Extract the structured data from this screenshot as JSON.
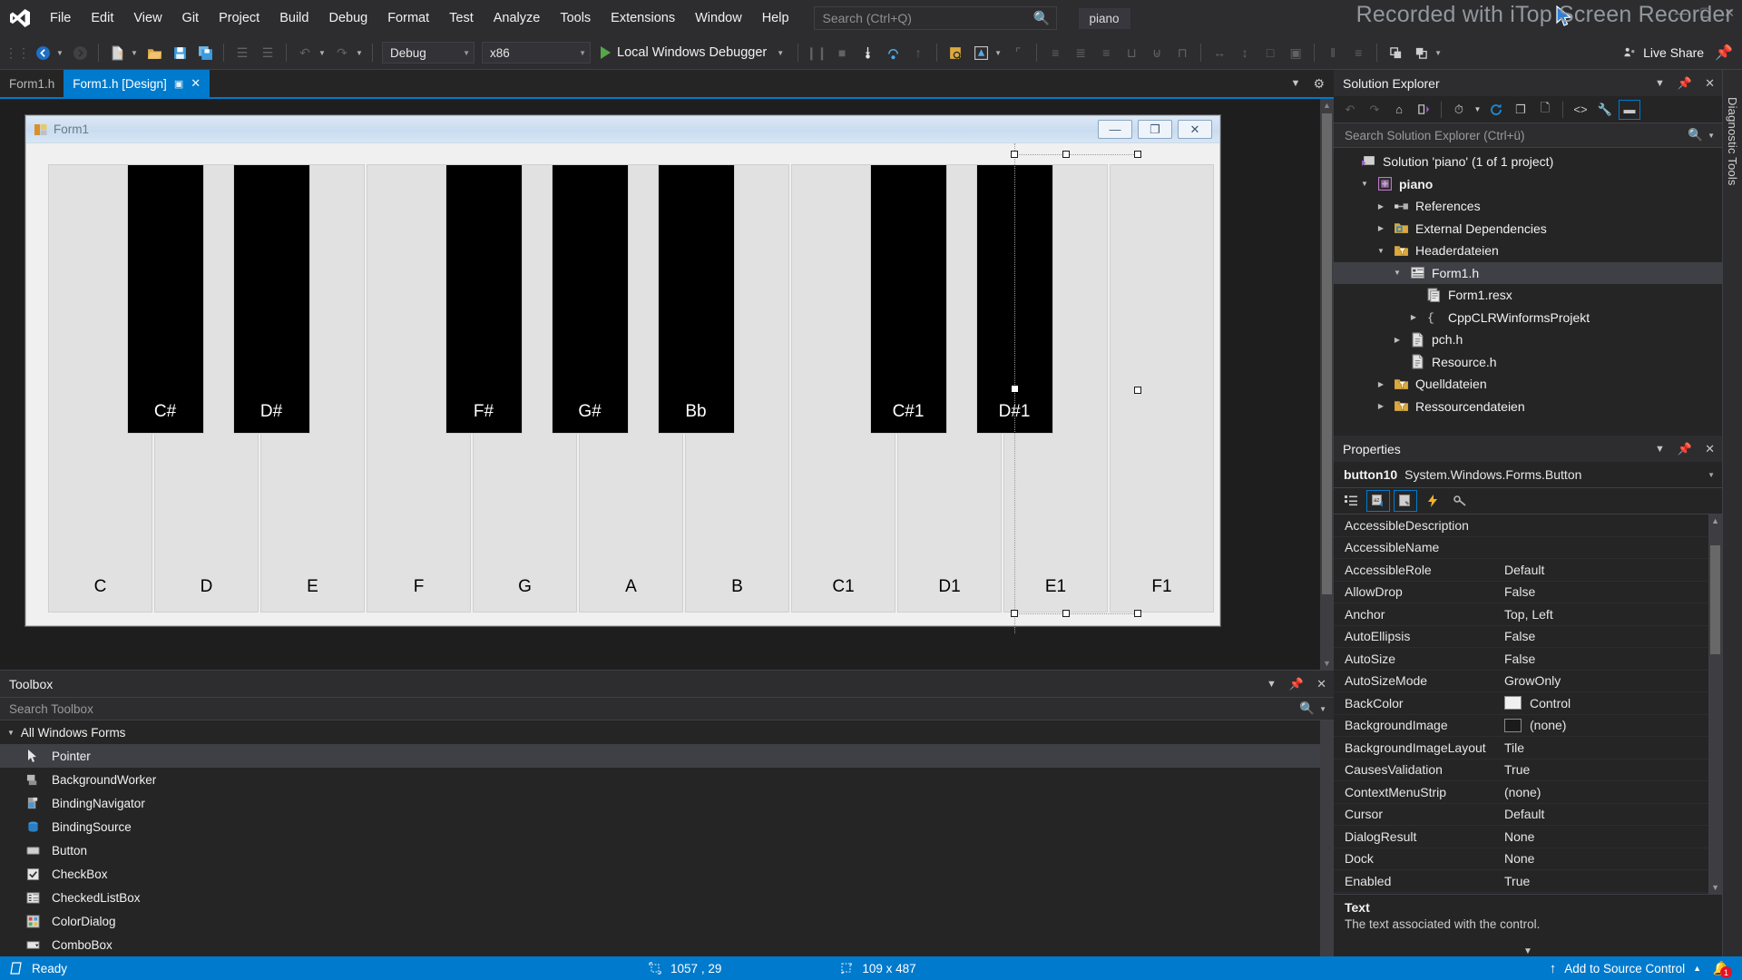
{
  "menu": {
    "items": [
      "File",
      "Edit",
      "View",
      "Git",
      "Project",
      "Build",
      "Debug",
      "Format",
      "Test",
      "Analyze",
      "Tools",
      "Extensions",
      "Window",
      "Help"
    ],
    "search_placeholder": "Search (Ctrl+Q)",
    "project_chip": "piano",
    "watermark": "Recorded with iTop Screen Recorder"
  },
  "toolbar": {
    "configuration": "Debug",
    "platform": "x86",
    "run_label": "Local Windows Debugger",
    "live_share": "Live Share"
  },
  "tabs": {
    "items": [
      {
        "label": "Form1.h",
        "active": false
      },
      {
        "label": "Form1.h [Design]",
        "active": true
      }
    ]
  },
  "designer": {
    "form_title": "Form1",
    "window_buttons": {
      "minimize": "—",
      "maximize": "❐",
      "close": "✕"
    },
    "white_keys": [
      "C",
      "D",
      "E",
      "F",
      "G",
      "A",
      "B",
      "C1",
      "D1",
      "E1",
      "F1"
    ],
    "black_keys": [
      {
        "label": "C#",
        "after": 0
      },
      {
        "label": "D#",
        "after": 1
      },
      {
        "label": "F#",
        "after": 3
      },
      {
        "label": "G#",
        "after": 4
      },
      {
        "label": "Bb",
        "after": 5
      },
      {
        "label": "C#1",
        "after": 7
      },
      {
        "label": "D#1",
        "after": 8
      }
    ],
    "selected_key": "D#1"
  },
  "toolbox": {
    "title": "Toolbox",
    "search_placeholder": "Search Toolbox",
    "group": "All Windows Forms",
    "items": [
      {
        "label": "Pointer",
        "icon": "pointer-icon",
        "selected": true
      },
      {
        "label": "BackgroundWorker",
        "icon": "background-worker-icon",
        "selected": false
      },
      {
        "label": "BindingNavigator",
        "icon": "binding-navigator-icon",
        "selected": false
      },
      {
        "label": "BindingSource",
        "icon": "binding-source-icon",
        "selected": false
      },
      {
        "label": "Button",
        "icon": "button-icon",
        "selected": false
      },
      {
        "label": "CheckBox",
        "icon": "checkbox-icon",
        "selected": false
      },
      {
        "label": "CheckedListBox",
        "icon": "checked-list-box-icon",
        "selected": false
      },
      {
        "label": "ColorDialog",
        "icon": "color-dialog-icon",
        "selected": false
      },
      {
        "label": "ComboBox",
        "icon": "combo-box-icon",
        "selected": false
      }
    ]
  },
  "solution_explorer": {
    "title": "Solution Explorer",
    "search_placeholder": "Search Solution Explorer (Ctrl+ü)",
    "tree": [
      {
        "label": "Solution 'piano' (1 of 1 project)",
        "indent": 0,
        "tri": "none",
        "icon": "solution-icon",
        "bold": false,
        "selected": false
      },
      {
        "label": "piano",
        "indent": 1,
        "tri": "open",
        "icon": "project-icon",
        "bold": true,
        "selected": false
      },
      {
        "label": "References",
        "indent": 2,
        "tri": "closed",
        "icon": "references-icon",
        "bold": false,
        "selected": false
      },
      {
        "label": "External Dependencies",
        "indent": 2,
        "tri": "closed",
        "icon": "ext-dep-icon",
        "bold": false,
        "selected": false
      },
      {
        "label": "Headerdateien",
        "indent": 2,
        "tri": "open",
        "icon": "folder-filter-icon",
        "bold": false,
        "selected": false
      },
      {
        "label": "Form1.h",
        "indent": 3,
        "tri": "open",
        "icon": "form-icon",
        "bold": false,
        "selected": true
      },
      {
        "label": "Form1.resx",
        "indent": 4,
        "tri": "none",
        "icon": "resx-icon",
        "bold": false,
        "selected": false
      },
      {
        "label": "CppCLRWinformsProjekt",
        "indent": 4,
        "tri": "closed",
        "icon": "braces-icon",
        "bold": false,
        "selected": false
      },
      {
        "label": "pch.h",
        "indent": 3,
        "tri": "closed",
        "icon": "header-file-icon",
        "bold": false,
        "selected": false
      },
      {
        "label": "Resource.h",
        "indent": 3,
        "tri": "none",
        "icon": "header-file-icon",
        "bold": false,
        "selected": false
      },
      {
        "label": "Quelldateien",
        "indent": 2,
        "tri": "closed",
        "icon": "folder-filter-icon",
        "bold": false,
        "selected": false
      },
      {
        "label": "Ressourcendateien",
        "indent": 2,
        "tri": "closed",
        "icon": "folder-filter-icon",
        "bold": false,
        "selected": false
      }
    ]
  },
  "diagnostic_tools_tab": "Diagnostic Tools",
  "properties": {
    "title": "Properties",
    "object_name": "button10",
    "object_type": "System.Windows.Forms.Button",
    "rows": [
      {
        "key": "AccessibleDescription",
        "value": "",
        "swatch": ""
      },
      {
        "key": "AccessibleName",
        "value": "",
        "swatch": ""
      },
      {
        "key": "AccessibleRole",
        "value": "Default",
        "swatch": ""
      },
      {
        "key": "AllowDrop",
        "value": "False",
        "swatch": ""
      },
      {
        "key": "Anchor",
        "value": "Top, Left",
        "swatch": ""
      },
      {
        "key": "AutoEllipsis",
        "value": "False",
        "swatch": ""
      },
      {
        "key": "AutoSize",
        "value": "False",
        "swatch": ""
      },
      {
        "key": "AutoSizeMode",
        "value": "GrowOnly",
        "swatch": ""
      },
      {
        "key": "BackColor",
        "value": "Control",
        "swatch": "#f0f0f0"
      },
      {
        "key": "BackgroundImage",
        "value": "(none)",
        "swatch": "#1b1b1b"
      },
      {
        "key": "BackgroundImageLayout",
        "value": "Tile",
        "swatch": ""
      },
      {
        "key": "CausesValidation",
        "value": "True",
        "swatch": ""
      },
      {
        "key": "ContextMenuStrip",
        "value": "(none)",
        "swatch": ""
      },
      {
        "key": "Cursor",
        "value": "Default",
        "swatch": ""
      },
      {
        "key": "DialogResult",
        "value": "None",
        "swatch": ""
      },
      {
        "key": "Dock",
        "value": "None",
        "swatch": ""
      },
      {
        "key": "Enabled",
        "value": "True",
        "swatch": ""
      }
    ],
    "description_title": "Text",
    "description_body": "The text associated with the control."
  },
  "statusbar": {
    "status": "Ready",
    "cursor_position": "1057 , 29",
    "size": "109 x 487",
    "source_control": "Add to Source Control",
    "notification_count": "1"
  }
}
